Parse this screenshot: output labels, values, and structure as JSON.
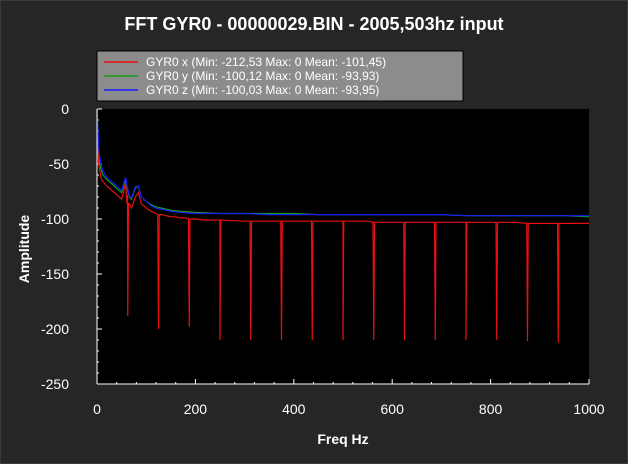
{
  "chart_data": {
    "type": "line",
    "title": "FFT GYR0 - 00000029.BIN - 2005,503hz input",
    "xlabel": "Freq Hz",
    "ylabel": "Amplitude",
    "xlim": [
      0,
      1000
    ],
    "ylim": [
      -250,
      0
    ],
    "xticks": [
      0,
      200,
      400,
      600,
      800,
      1000
    ],
    "yticks": [
      0,
      -50,
      -100,
      -150,
      -200,
      -250
    ],
    "grid": false,
    "legend_position": "top-left",
    "background": "#000000",
    "series": [
      {
        "name": "GYR0 x (Min: -212,53 Max: 0 Mean: -101,45)",
        "color": "#e81010",
        "x": [
          0,
          4,
          8,
          12,
          20,
          30,
          40,
          50,
          58,
          62,
          66,
          70,
          78,
          84,
          90,
          100,
          110,
          120,
          128,
          132,
          140,
          150,
          160,
          170,
          180,
          190,
          200,
          220,
          250,
          300,
          350,
          400,
          450,
          500,
          550,
          600,
          650,
          700,
          750,
          800,
          850,
          900,
          950,
          1000
        ],
        "y": [
          -30,
          -52,
          -62,
          -66,
          -70,
          -74,
          -78,
          -82,
          -68,
          -78,
          -86,
          -90,
          -80,
          -76,
          -86,
          -90,
          -93,
          -95,
          -96,
          -96,
          -97,
          -98,
          -98,
          -99,
          -99,
          -100,
          -100,
          -101,
          -101,
          -102,
          -102,
          -102,
          -102,
          -102,
          -102,
          -103,
          -103,
          -103,
          -103,
          -103,
          -103,
          -104,
          -104,
          -104
        ],
        "spikes": [
          {
            "x": 62.5,
            "y": -188
          },
          {
            "x": 125,
            "y": -200
          },
          {
            "x": 187.5,
            "y": -198
          },
          {
            "x": 250,
            "y": -210
          },
          {
            "x": 312.5,
            "y": -210
          },
          {
            "x": 375,
            "y": -210
          },
          {
            "x": 437.5,
            "y": -210
          },
          {
            "x": 500,
            "y": -210
          },
          {
            "x": 562.5,
            "y": -210
          },
          {
            "x": 625,
            "y": -210
          },
          {
            "x": 687.5,
            "y": -210
          },
          {
            "x": 750,
            "y": -210
          },
          {
            "x": 812.5,
            "y": -210
          },
          {
            "x": 875,
            "y": -211
          },
          {
            "x": 937.5,
            "y": -212.53
          }
        ]
      },
      {
        "name": "GYR0 y (Min: -100,12 Max: 0 Mean: -93,93)",
        "color": "#18a018",
        "x": [
          0,
          4,
          8,
          12,
          20,
          30,
          40,
          50,
          58,
          62,
          66,
          70,
          78,
          84,
          90,
          100,
          110,
          120,
          130,
          140,
          150,
          170,
          200,
          250,
          300,
          350,
          400,
          450,
          500,
          550,
          600,
          650,
          700,
          750,
          800,
          850,
          900,
          950,
          1000
        ],
        "y": [
          0,
          -45,
          -55,
          -60,
          -64,
          -68,
          -72,
          -76,
          -64,
          -74,
          -80,
          -82,
          -72,
          -70,
          -80,
          -84,
          -87,
          -89,
          -90,
          -91,
          -92,
          -93,
          -94,
          -95,
          -95,
          -95,
          -95,
          -96,
          -96,
          -96,
          -96,
          -96,
          -96,
          -97,
          -97,
          -97,
          -97,
          -97,
          -98
        ]
      },
      {
        "name": "GYR0 z (Min: -100,03 Max: 0 Mean: -93,95)",
        "color": "#1a1aff",
        "x": [
          0,
          2,
          4,
          8,
          12,
          20,
          30,
          40,
          50,
          58,
          62,
          66,
          70,
          78,
          84,
          90,
          100,
          110,
          120,
          130,
          140,
          150,
          170,
          200,
          250,
          300,
          350,
          400,
          450,
          500,
          550,
          600,
          650,
          700,
          750,
          800,
          850,
          900,
          950,
          1000
        ],
        "y": [
          0,
          -20,
          -38,
          -50,
          -56,
          -62,
          -66,
          -70,
          -74,
          -62,
          -72,
          -79,
          -81,
          -71,
          -70,
          -80,
          -84,
          -88,
          -90,
          -91,
          -92,
          -93,
          -94,
          -95,
          -95,
          -95,
          -96,
          -96,
          -96,
          -96,
          -96,
          -96,
          -96,
          -96,
          -97,
          -97,
          -97,
          -97,
          -97,
          -97
        ]
      }
    ]
  }
}
